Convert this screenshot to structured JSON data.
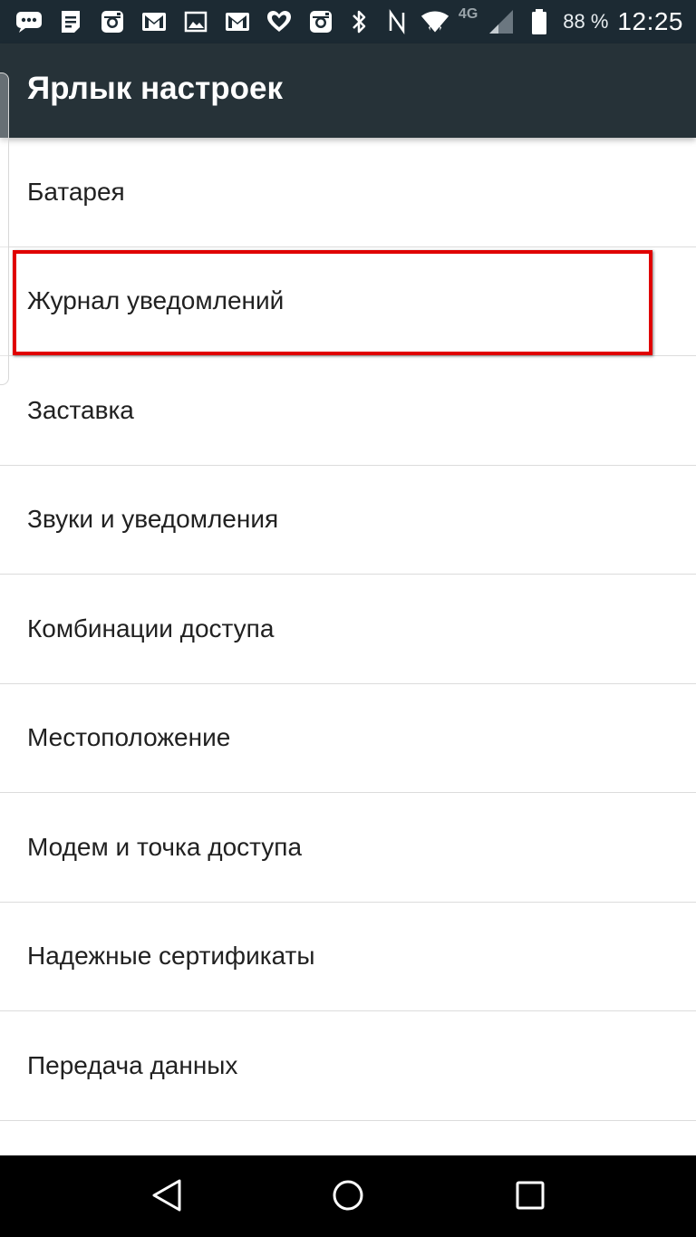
{
  "status_bar": {
    "network_type": "4G",
    "battery_percent": "88 %",
    "time": "12:25",
    "left_icons": [
      "chat-icon",
      "notes-icon",
      "instagram-icon",
      "gmail-icon",
      "gallery-icon",
      "gmail-icon",
      "heart-icon",
      "instagram-icon"
    ],
    "right_icons": [
      "bluetooth-icon",
      "nfc-icon",
      "wifi-icon",
      "signal-icon",
      "battery-icon"
    ]
  },
  "app_bar": {
    "title": "Ярлык настроек"
  },
  "settings": {
    "items": [
      {
        "label": "Батарея"
      },
      {
        "label": "Журнал уведомлений"
      },
      {
        "label": "Заставка"
      },
      {
        "label": "Звуки и уведомления"
      },
      {
        "label": "Комбинации доступа"
      },
      {
        "label": "Местоположение"
      },
      {
        "label": "Модем и точка доступа"
      },
      {
        "label": "Надежные сертификаты"
      },
      {
        "label": "Передача данных"
      },
      {
        "label": ""
      }
    ],
    "highlighted_item": "Журнал уведомлений",
    "highlight_color": "#e00000"
  },
  "nav_bar": {
    "buttons": [
      "back-icon",
      "home-icon",
      "recents-icon"
    ]
  },
  "colors": {
    "status_bar": "#1c2a33",
    "app_bar": "#263238",
    "divider": "#dcdcdc",
    "text": "#212121"
  }
}
